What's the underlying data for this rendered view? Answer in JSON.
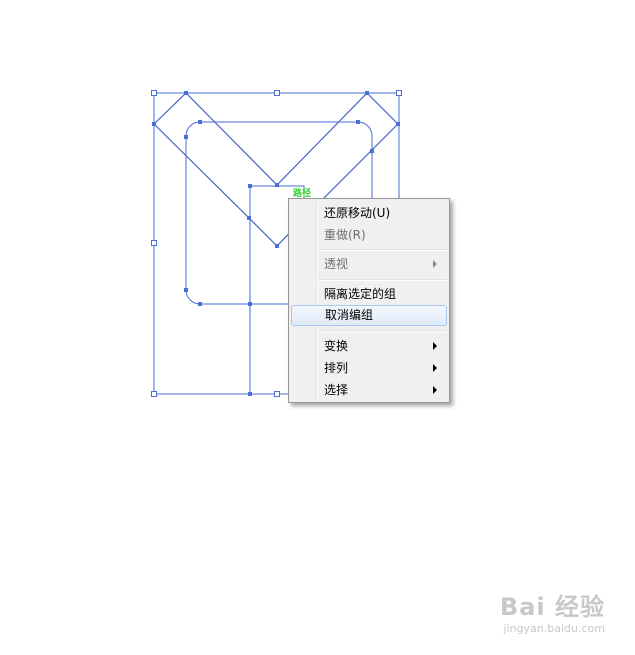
{
  "smart_guide_label": "路径",
  "context_menu": {
    "items": [
      {
        "label": "还原移动(U)",
        "disabled": false,
        "submenu": false
      },
      {
        "label": "重做(R)",
        "disabled": true,
        "submenu": false
      },
      {
        "label": "透视",
        "disabled": true,
        "submenu": true
      },
      {
        "label": "隔离选定的组",
        "disabled": false,
        "submenu": false
      },
      {
        "label": "取消编组",
        "disabled": false,
        "submenu": false,
        "highlighted": true
      },
      {
        "label": "变换",
        "disabled": false,
        "submenu": true
      },
      {
        "label": "排列",
        "disabled": false,
        "submenu": true
      },
      {
        "label": "选择",
        "disabled": false,
        "submenu": true
      }
    ]
  },
  "watermark": {
    "logo": "Bai 经验",
    "url": "jingyan.baidu.com"
  },
  "colors": {
    "selection": "#4a6fd8",
    "annotation_arrow": "#e82020",
    "smart_guide": "#3cd13c"
  }
}
